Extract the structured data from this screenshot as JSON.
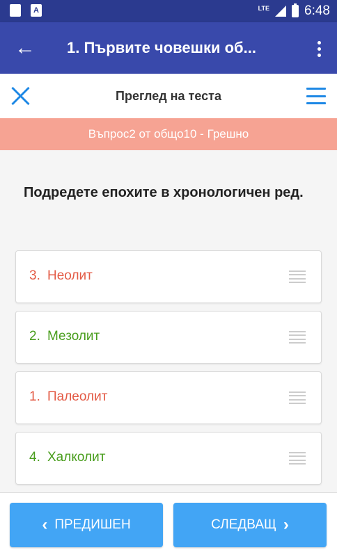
{
  "status_bar": {
    "network": "LTE",
    "time": "6:48",
    "icons": [
      "sd-card-icon",
      "a-icon",
      "signal-icon",
      "battery-charging-icon"
    ]
  },
  "app_bar": {
    "back_icon": "←",
    "title": "1. Първите човешки об..."
  },
  "review": {
    "title": "Преглед на теста"
  },
  "status_banner": {
    "text": "Въпрос2 от общо10 - Грешно",
    "color": "#f6a393"
  },
  "question": {
    "text": "Подредете епохите в хронологичен ред."
  },
  "answers": [
    {
      "number": "3.",
      "label": "Неолит",
      "status": "wrong",
      "color": "#e35a45"
    },
    {
      "number": "2.",
      "label": "Мезолит",
      "status": "correct",
      "color": "#4a9e1e"
    },
    {
      "number": "1.",
      "label": "Палеолит",
      "status": "wrong",
      "color": "#e35a45"
    },
    {
      "number": "4.",
      "label": "Халколит",
      "status": "correct",
      "color": "#4a9e1e"
    }
  ],
  "navigation": {
    "prev_label": "ПРЕДИШЕН",
    "next_label": "СЛЕДВАЩ",
    "accent": "#42a5f5"
  }
}
